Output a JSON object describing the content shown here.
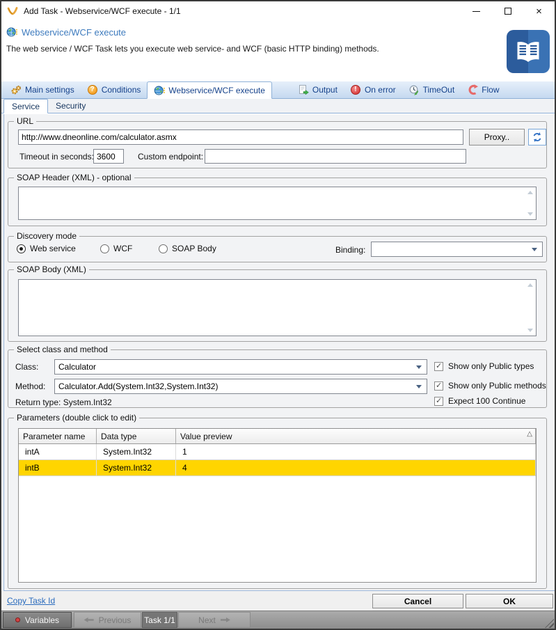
{
  "window": {
    "title": "Add Task - Webservice/WCF execute - 1/1",
    "close_glyph": "×"
  },
  "header": {
    "title": "Webservice/WCF execute",
    "description": "The web service / WCF Task lets you execute web service- and WCF (basic HTTP binding) methods."
  },
  "tabs": [
    {
      "label": "Main settings"
    },
    {
      "label": "Conditions"
    },
    {
      "label": "Webservice/WCF execute"
    },
    {
      "label": "Output"
    },
    {
      "label": "On error"
    },
    {
      "label": "TimeOut"
    },
    {
      "label": "Flow"
    }
  ],
  "subtabs": [
    {
      "label": "Service"
    },
    {
      "label": "Security"
    }
  ],
  "service": {
    "url_group": {
      "label": "URL",
      "url_value": "http://www.dneonline.com/calculator.asmx",
      "proxy_button": "Proxy..",
      "timeout_label": "Timeout in seconds:",
      "timeout_value": "3600",
      "endpoint_label": "Custom endpoint:",
      "endpoint_value": ""
    },
    "soap_header_group": {
      "label": "SOAP Header (XML) - optional",
      "value": ""
    },
    "discovery_group": {
      "label": "Discovery mode",
      "options": [
        {
          "label": "Web service",
          "selected": true
        },
        {
          "label": "WCF",
          "selected": false
        },
        {
          "label": "SOAP Body",
          "selected": false
        }
      ],
      "binding_label": "Binding:",
      "binding_value": ""
    },
    "soap_body_group": {
      "label": "SOAP Body (XML)",
      "value": ""
    },
    "class_group": {
      "label": "Select class and method",
      "class_label": "Class:",
      "class_value": "Calculator",
      "method_label": "Method:",
      "method_value": "Calculator.Add(System.Int32,System.Int32)",
      "return_type_text": "Return type: System.Int32",
      "checkboxes": [
        {
          "label": "Show only Public types",
          "checked": true
        },
        {
          "label": "Show only Public methods",
          "checked": true
        },
        {
          "label": "Expect 100 Continue",
          "checked": true
        }
      ]
    },
    "parameters_group": {
      "label": "Parameters (double click to edit)",
      "sort_glyph": "△",
      "columns": [
        "Parameter name",
        "Data type",
        "Value preview"
      ],
      "rows": [
        {
          "name": "intA",
          "type": "System.Int32",
          "value": "1"
        },
        {
          "name": "intB",
          "type": "System.Int32",
          "value": "4"
        }
      ]
    }
  },
  "footer": {
    "copy_task_link": "Copy Task Id",
    "cancel_button": "Cancel",
    "ok_button": "OK"
  },
  "statusbar": {
    "variables_button": "Variables",
    "previous_button": "Previous",
    "task_indicator": "Task 1/1",
    "next_button": "Next"
  },
  "icons": {
    "conditions_glyph": "?",
    "on_error_glyph": "!"
  },
  "colors": {
    "accent_blue": "#3e7bbe",
    "tab_text": "#15428b",
    "selected_row_yellow": "#ffd500",
    "book_icon_blue": "#2d5d9f",
    "link_blue": "#2a6bbd"
  }
}
